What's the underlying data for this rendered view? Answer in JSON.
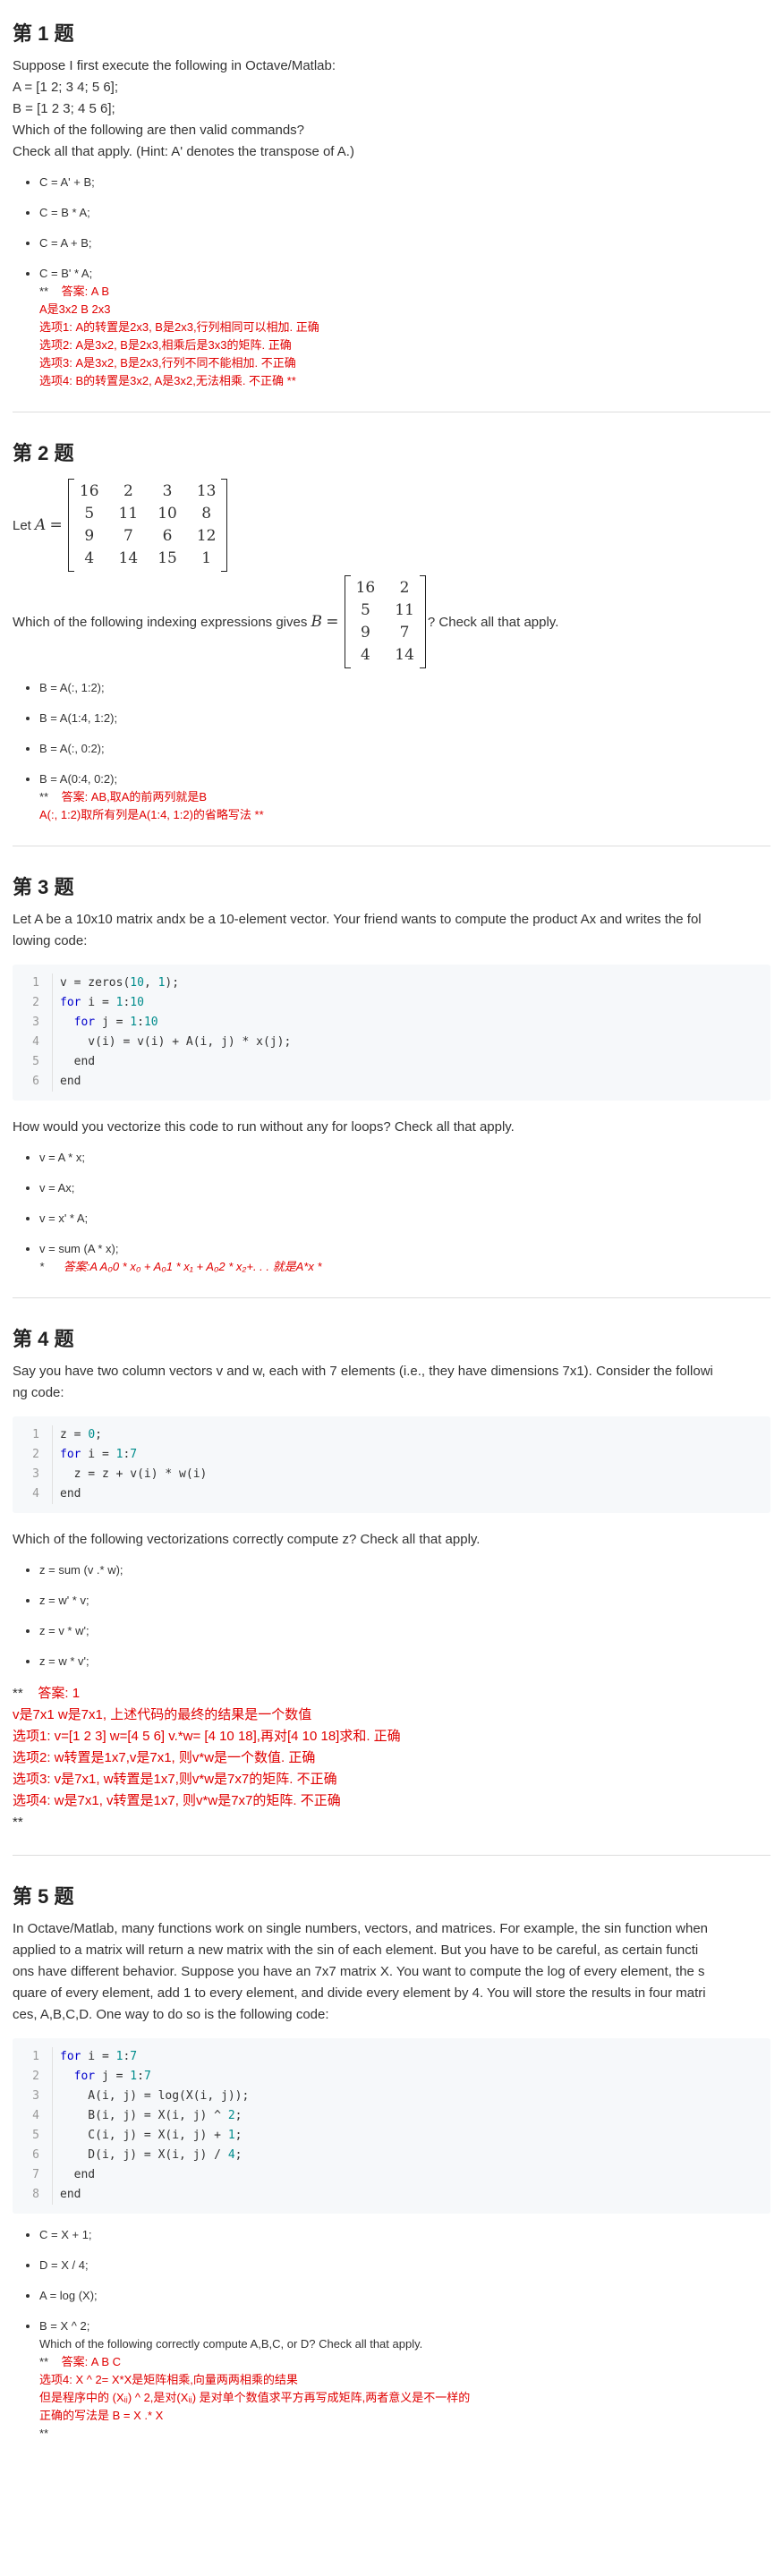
{
  "q1": {
    "title": "第 1 题",
    "lines": [
      "Suppose I first execute the following in Octave/Matlab:",
      "A = [1 2; 3 4; 5 6];",
      "B = [1 2 3; 4 5 6];",
      "Which of the following are then valid commands?",
      "Check all that apply. (Hint: A' denotes the transpose of A.)"
    ],
    "options": [
      "C = A' + B;",
      "C = B * A;",
      "C = A + B;",
      "C = B' * A;"
    ],
    "answer_prefix": "**",
    "answer_lines": [
      "答案: A B",
      "A是3x2 B 2x3",
      "选项1: A的转置是2x3, B是2x3,行列相同可以相加. 正确",
      "选项2: A是3x2, B是2x3,相乘后是3x3的矩阵. 正确",
      "选项3: A是3x2, B是2x3,行列不同不能相加. 不正确",
      "选项4: B的转置是3x2, A是3x2,无法相乘. 不正确 **"
    ]
  },
  "q2": {
    "title": "第 2 题",
    "let": "Let",
    "A_name": "A",
    "eq": "=",
    "A": [
      "16",
      "2",
      "3",
      "13",
      "5",
      "11",
      "10",
      "8",
      "9",
      "7",
      "6",
      "12",
      "4",
      "14",
      "15",
      "1"
    ],
    "q_before": "Which of the following indexing expressions gives",
    "B_name": "B",
    "B": [
      "16",
      "2",
      "5",
      "11",
      "9",
      "7",
      "4",
      "14"
    ],
    "q_after": "? Check all that apply.",
    "options": [
      "B = A(:, 1:2);",
      "B = A(1:4, 1:2);",
      "B = A(:, 0:2);",
      "B = A(0:4, 0:2);"
    ],
    "answer_prefix": "**",
    "answer_lines": [
      "答案: AB,取A的前两列就是B",
      "A(:, 1:2)取所有列是A(1:4, 1:2)的省略写法 **"
    ]
  },
  "q3": {
    "title": "第 3 题",
    "intro": "Let A be a 10x10 matrix andx be a 10-element vector. Your friend wants to compute the product Ax and writes the fol\nlowing code:",
    "question": "How would you vectorize this code to run without any for loops? Check all that apply.",
    "options": [
      "v = A * x;",
      "v = Ax;",
      "v = x' * A;",
      "v = sum (A * x);"
    ],
    "answer": "答案:A A₀0 * x₀ + A₀1 * x₁ + A₀2 * x₂+. . . 就是A*x *",
    "answer_prefix": "*"
  },
  "q4": {
    "title": "第 4 题",
    "intro": "Say you have two column vectors v and w, each with 7 elements (i.e., they have dimensions 7x1). Consider the followi\nng code:",
    "question": "Which of the following vectorizations correctly compute z? Check all that apply.",
    "options": [
      "z = sum (v .* w);",
      "z = w' * v;",
      "z = v * w';",
      "z = w * v';"
    ],
    "answer_lines": [
      "**    答案: 1",
      "v是7x1 w是7x1, 上述代码的最终的结果是一个数值",
      "选项1: v=[1 2 3] w=[4 5 6] v.*w= [4 10 18],再对[4 10 18]求和. 正确",
      "选项2: w转置是1x7,v是7x1, 则v*w是一个数值. 正确",
      "选项3: v是7x1, w转置是1x7,则v*w是7x7的矩阵. 不正确",
      "选项4: w是7x1, v转置是1x7, 则v*w是7x7的矩阵. 不正确",
      "**"
    ]
  },
  "q5": {
    "title": "第 5 题",
    "intro": "In Octave/Matlab, many functions work on single numbers, vectors, and matrices. For example, the sin function when\napplied to a matrix will return a new matrix with the sin of each element. But you have to be careful, as certain functi\nons have different behavior. Suppose you have an 7x7 matrix X. You want to compute the log of every element, the s\nquare of every element, add 1 to every element, and divide every element by 4. You will store the results in four matri\nces, A,B,C,D. One way to do so is the following code:",
    "options": [
      "C = X + 1;",
      "D = X / 4;",
      "A = log (X);",
      "B = X ^ 2;"
    ],
    "after_option": "Which of the following correctly compute A,B,C, or D? Check all that apply.",
    "answer_lines": [
      "**    答案: A B C",
      "选项4: X ^ 2= X*X是矩阵相乘,向量两两相乘的结果",
      "但是程序中的 (Xᵢⱼ) ^ 2,是对(Xᵢⱼ) 是对单个数值求平方再写成矩阵,两者意义是不一样的",
      "正确的写法是 B = X .* X",
      "**"
    ]
  },
  "code3": [
    "1",
    "2",
    "3",
    "4",
    "5",
    "6"
  ],
  "code4": [
    "1",
    "2",
    "3",
    "4"
  ],
  "code5": [
    "1",
    "2",
    "3",
    "4",
    "5",
    "6",
    "7",
    "8"
  ]
}
